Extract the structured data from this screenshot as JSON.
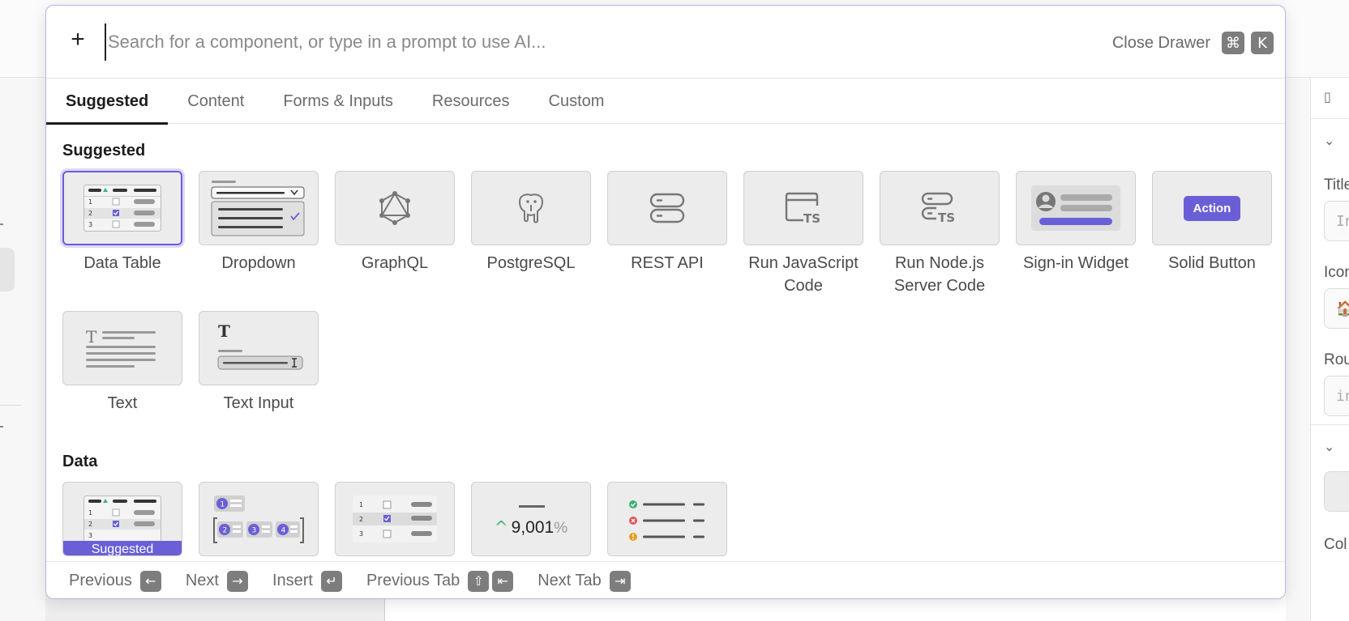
{
  "search": {
    "placeholder": "Search for a component, or type in a prompt to use AI...",
    "close_label": "Close Drawer",
    "shortcut_keys": [
      "⌘",
      "K"
    ]
  },
  "tabs": [
    {
      "label": "Suggested",
      "active": true
    },
    {
      "label": "Content",
      "active": false
    },
    {
      "label": "Forms & Inputs",
      "active": false
    },
    {
      "label": "Resources",
      "active": false
    },
    {
      "label": "Custom",
      "active": false
    }
  ],
  "sections": {
    "suggested": {
      "title": "Suggested",
      "items": [
        {
          "label": "Data Table",
          "icon": "data-table-icon",
          "selected": true
        },
        {
          "label": "Dropdown",
          "icon": "dropdown-icon"
        },
        {
          "label": "GraphQL",
          "icon": "graphql-icon"
        },
        {
          "label": "PostgreSQL",
          "icon": "postgresql-icon"
        },
        {
          "label": "REST API",
          "icon": "rest-api-icon"
        },
        {
          "label": "Run JavaScript Code",
          "icon": "javascript-ts-icon"
        },
        {
          "label": "Run Node.js Server Code",
          "icon": "nodejs-ts-icon"
        },
        {
          "label": "Sign-in Widget",
          "icon": "signin-widget-icon"
        },
        {
          "label": "Solid Button",
          "icon": "solid-button-icon",
          "button_text": "Action"
        },
        {
          "label": "Text",
          "icon": "text-icon"
        },
        {
          "label": "Text Input",
          "icon": "text-input-icon"
        }
      ]
    },
    "data": {
      "title": "Data",
      "items": [
        {
          "icon": "data-table-icon",
          "badge": "Suggested"
        },
        {
          "icon": "steps-icon",
          "step_numbers": [
            "1",
            "2",
            "3",
            "4"
          ]
        },
        {
          "icon": "checklist-table-icon"
        },
        {
          "icon": "statistic-icon",
          "value": "9,001",
          "unit": "%"
        },
        {
          "icon": "status-list-icon"
        }
      ]
    }
  },
  "footer": [
    {
      "label": "Previous",
      "keys": [
        "←"
      ]
    },
    {
      "label": "Next",
      "keys": [
        "→"
      ]
    },
    {
      "label": "Insert",
      "keys": [
        "↵"
      ]
    },
    {
      "label": "Previous Tab",
      "keys": [
        "⇧",
        "⇤"
      ]
    },
    {
      "label": "Next Tab",
      "keys": [
        "⇥"
      ]
    }
  ],
  "background": {
    "right_panel_labels": [
      "Title",
      "Icon",
      "Rou",
      "Col"
    ],
    "right_panel_placeholders": [
      "In",
      "in"
    ],
    "right_panel_icon_glyph": "🏠"
  },
  "colors": {
    "accent": "#6a5fd6",
    "drawer_border": "#b8b3ea",
    "tile_bg": "#ececec",
    "key_bg": "#7d7d7d"
  }
}
